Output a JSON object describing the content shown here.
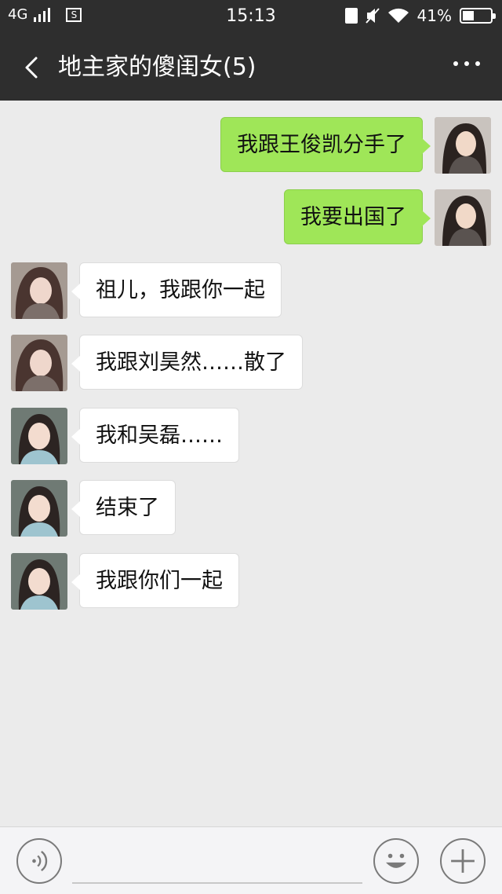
{
  "status_bar": {
    "network": "4G",
    "sim_label": "S",
    "time": "15:13",
    "battery_percent": "41%",
    "battery_level": 0.41
  },
  "header": {
    "title": "地主家的傻闺女(5)"
  },
  "messages": [
    {
      "side": "right",
      "sender": "self",
      "text": "我跟王俊凯分手了"
    },
    {
      "side": "right",
      "sender": "self",
      "text": "我要出国了"
    },
    {
      "side": "left",
      "sender": "member-a",
      "text": "祖儿，我跟你一起"
    },
    {
      "side": "left",
      "sender": "member-a",
      "text": "我跟刘昊然……散了"
    },
    {
      "side": "left",
      "sender": "member-b",
      "text": "我和吴磊……"
    },
    {
      "side": "left",
      "sender": "member-b",
      "text": "结束了"
    },
    {
      "side": "left",
      "sender": "member-b",
      "text": "我跟你们一起"
    }
  ],
  "input_bar": {
    "voice_icon": "voice-icon",
    "emoji_icon": "emoji-icon",
    "plus_icon": "plus-icon"
  },
  "colors": {
    "header_bg": "#2e2e2e",
    "chat_bg": "#ebebeb",
    "bubble_self": "#9fe658",
    "bubble_other": "#ffffff"
  }
}
